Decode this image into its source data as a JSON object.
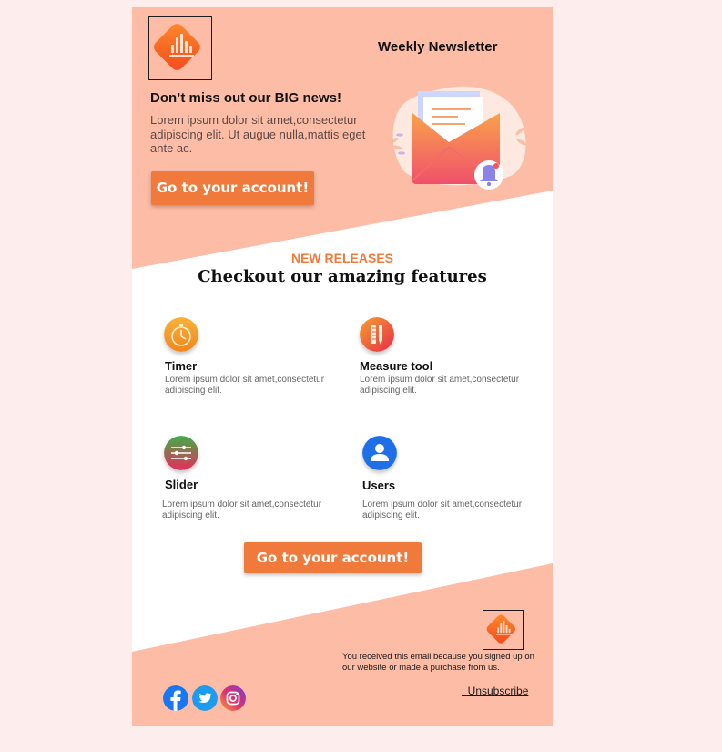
{
  "header": {
    "title": "Weekly Newsletter",
    "headline": "Don’t miss out our BIG news!",
    "intro": "Lorem ipsum dolor sit amet,consectetur adipiscing elit. Ut augue nulla,mattis eget ante ac.",
    "cta_label": "Go to your account!"
  },
  "features_section": {
    "eyebrow": "NEW RELEASES",
    "title": "Checkout our amazing features",
    "items": [
      {
        "title": "Timer",
        "description": "Lorem ipsum dolor sit amet,consectetur adipiscing elit.",
        "icon": "timer-icon"
      },
      {
        "title": "Measure tool",
        "description": "Lorem ipsum dolor sit amet,consectetur adipiscing elit.",
        "icon": "measure-tool-icon"
      },
      {
        "title": "Slider",
        "description": "Lorem ipsum dolor sit amet,consectetur adipiscing elit.",
        "icon": "slider-icon"
      },
      {
        "title": "Users",
        "description": "Lorem ipsum dolor sit amet,consectetur adipiscing elit.",
        "icon": "user-icon"
      }
    ],
    "cta_label": "Go to your account!"
  },
  "footer": {
    "note": "You received this email because you signed up on our website or made a purchase from us.",
    "unsubscribe_label": "  Unsubscribe",
    "social_icons": [
      "facebook-icon",
      "twitter-icon",
      "instagram-icon"
    ]
  },
  "colors": {
    "page_background": "#fdeeed",
    "header_background": "#fdbca5",
    "accent": "#f07a3c",
    "card_background": "#ffffff"
  }
}
